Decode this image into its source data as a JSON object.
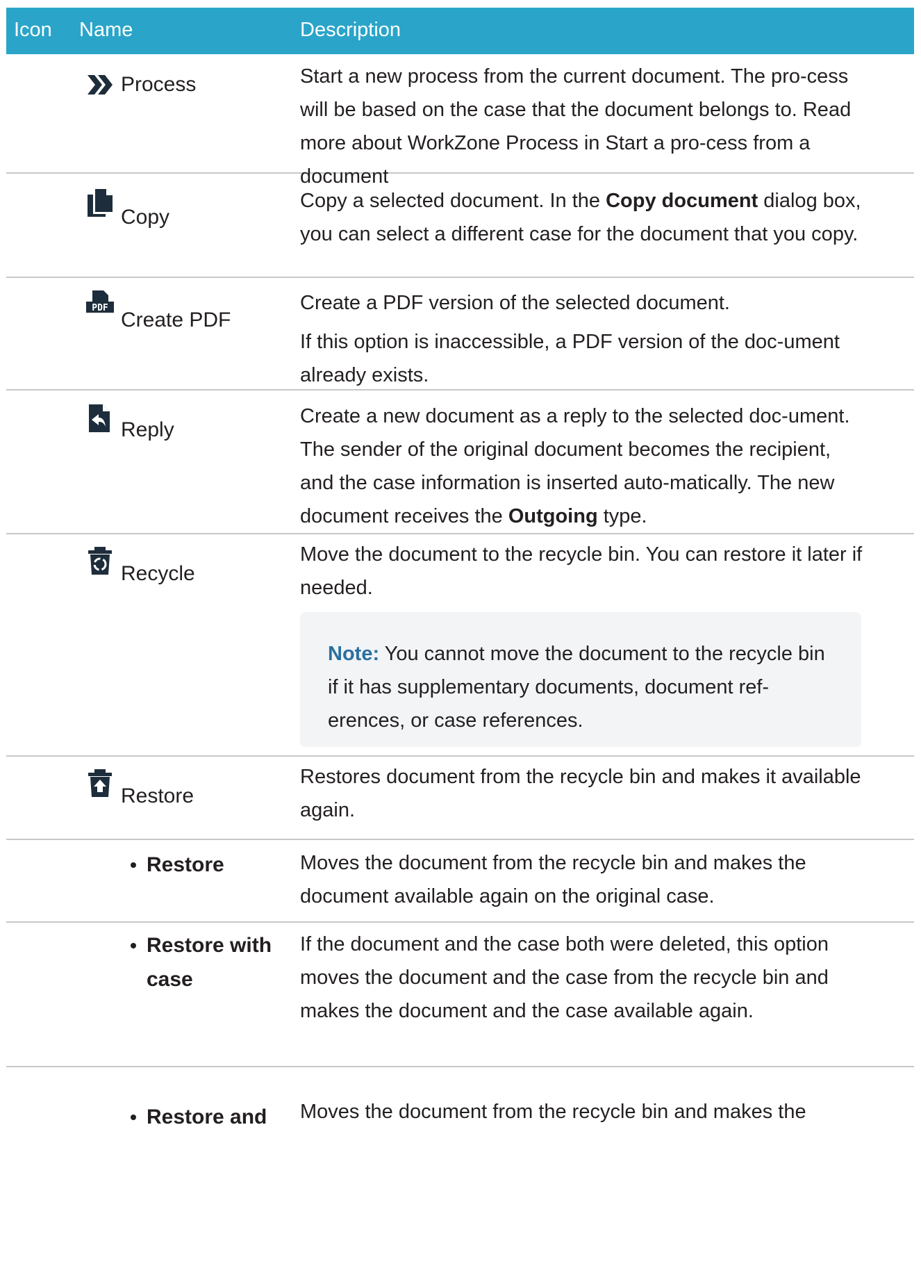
{
  "header": {
    "icon": "Icon",
    "name": "Name",
    "description": "Description"
  },
  "rows": [
    {
      "name": "Process",
      "icon": "double-chevron-right-icon",
      "description": "Start a new process from the current document. The pro-cess will be based on the case that the document belongs to. Read more about WorkZone Process in Start a pro-cess from a document"
    },
    {
      "name": "Copy",
      "icon": "copy-document-icon",
      "desc_pre": "Copy a selected document. In the ",
      "desc_bold": "Copy document",
      "desc_post": " dialog box, you can select a different case for the document that you copy."
    },
    {
      "name": "Create PDF",
      "icon": "pdf-document-icon",
      "description": "Create a PDF version of the selected document.",
      "description2": "If this option is inaccessible, a PDF version of the doc-ument already exists."
    },
    {
      "name": "Reply",
      "icon": "reply-document-icon",
      "desc_pre": "Create a new document as a reply to the selected doc-ument. The sender of the original document becomes the recipient, and the case information is inserted auto-matically. The new document receives the ",
      "desc_bold": "Outgoing",
      "desc_post": " type."
    },
    {
      "name": "Recycle",
      "icon": "recycle-bin-icon",
      "description": "Move the document to the recycle bin. You can restore it later if needed.",
      "note_label": "Note:",
      "note_text": " You cannot move the document to the recycle bin if it has supplementary documents, document ref-erences, or case references."
    },
    {
      "name": "Restore",
      "icon": "restore-bin-icon",
      "description": "Restores document from the recycle bin and makes it available again."
    },
    {
      "name": "Restore",
      "description": "Moves the document from the recycle bin and makes the document available again on the original case."
    },
    {
      "name": "Restore with case",
      "description": "If the document and the case both were deleted, this option moves the document and the case from the recycle bin and makes the document and the case available again."
    },
    {
      "name": "Restore and",
      "description": "Moves the document from the recycle bin and makes the"
    }
  ],
  "pdf_icon_text": "PDF",
  "colors": {
    "header": "#2aa5c9",
    "icon": "#1e2d3b",
    "note_label": "#2a6fa0",
    "note_bg": "#f2f4f6"
  }
}
